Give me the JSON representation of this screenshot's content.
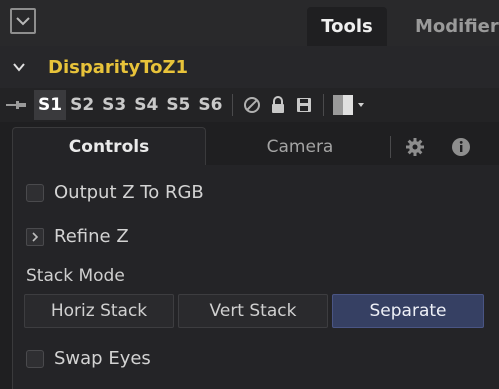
{
  "header": {
    "tabs": [
      {
        "label": "Tools",
        "active": true
      },
      {
        "label": "Modifiers",
        "active": false
      }
    ]
  },
  "node": {
    "title": "DisparityToZ1"
  },
  "toolbar": {
    "slots": [
      "S1",
      "S2",
      "S3",
      "S4",
      "S5",
      "S6"
    ],
    "active_slot": "S1"
  },
  "subtabs": {
    "controls": "Controls",
    "camera": "Camera"
  },
  "controls": {
    "output_z_label": "Output Z To RGB",
    "output_z_checked": false,
    "refine_label": "Refine Z",
    "stack_mode_label": "Stack Mode",
    "stack_options": [
      "Horiz Stack",
      "Vert Stack",
      "Separate"
    ],
    "stack_selected": "Separate",
    "swap_eyes_label": "Swap Eyes",
    "swap_eyes_checked": false
  },
  "colors": {
    "accent": "#e8c33a",
    "selected_segment": "#364063",
    "background": "#1f1f21"
  }
}
